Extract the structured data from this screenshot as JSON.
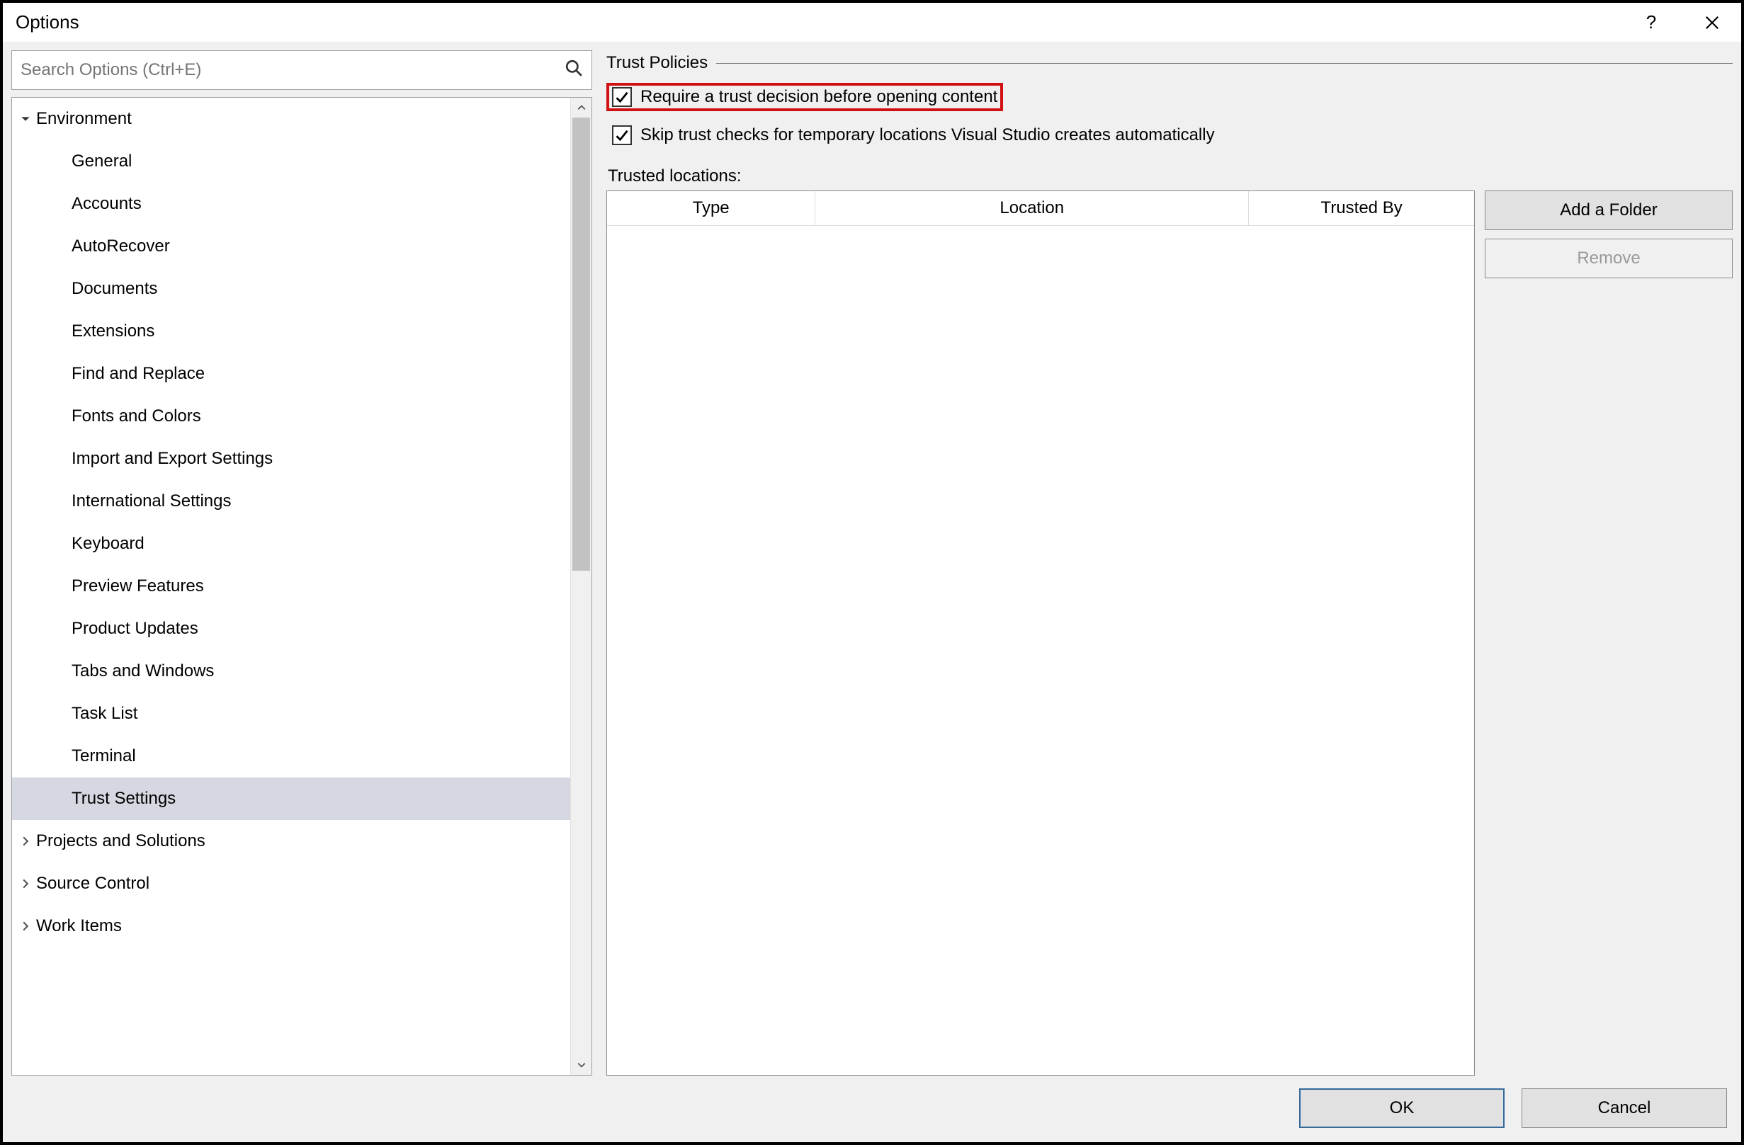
{
  "window": {
    "title": "Options"
  },
  "search": {
    "placeholder": "Search Options (Ctrl+E)"
  },
  "tree": {
    "environment": {
      "label": "Environment",
      "children": [
        "General",
        "Accounts",
        "AutoRecover",
        "Documents",
        "Extensions",
        "Find and Replace",
        "Fonts and Colors",
        "Import and Export Settings",
        "International Settings",
        "Keyboard",
        "Preview Features",
        "Product Updates",
        "Tabs and Windows",
        "Task List",
        "Terminal",
        "Trust Settings"
      ],
      "selected": "Trust Settings"
    },
    "projects": {
      "label": "Projects and Solutions"
    },
    "source": {
      "label": "Source Control"
    },
    "work": {
      "label": "Work Items"
    }
  },
  "policies": {
    "group_label": "Trust Policies",
    "require_trust": {
      "label": "Require a trust decision before opening content",
      "checked": true,
      "highlighted": true
    },
    "skip_temp": {
      "label": "Skip trust checks for temporary locations Visual Studio creates automatically",
      "checked": true
    },
    "trusted_locations_label": "Trusted locations:",
    "columns": {
      "type": "Type",
      "location": "Location",
      "trusted_by": "Trusted By"
    },
    "rows": []
  },
  "buttons": {
    "add_folder": "Add a Folder",
    "remove": "Remove",
    "ok": "OK",
    "cancel": "Cancel"
  }
}
